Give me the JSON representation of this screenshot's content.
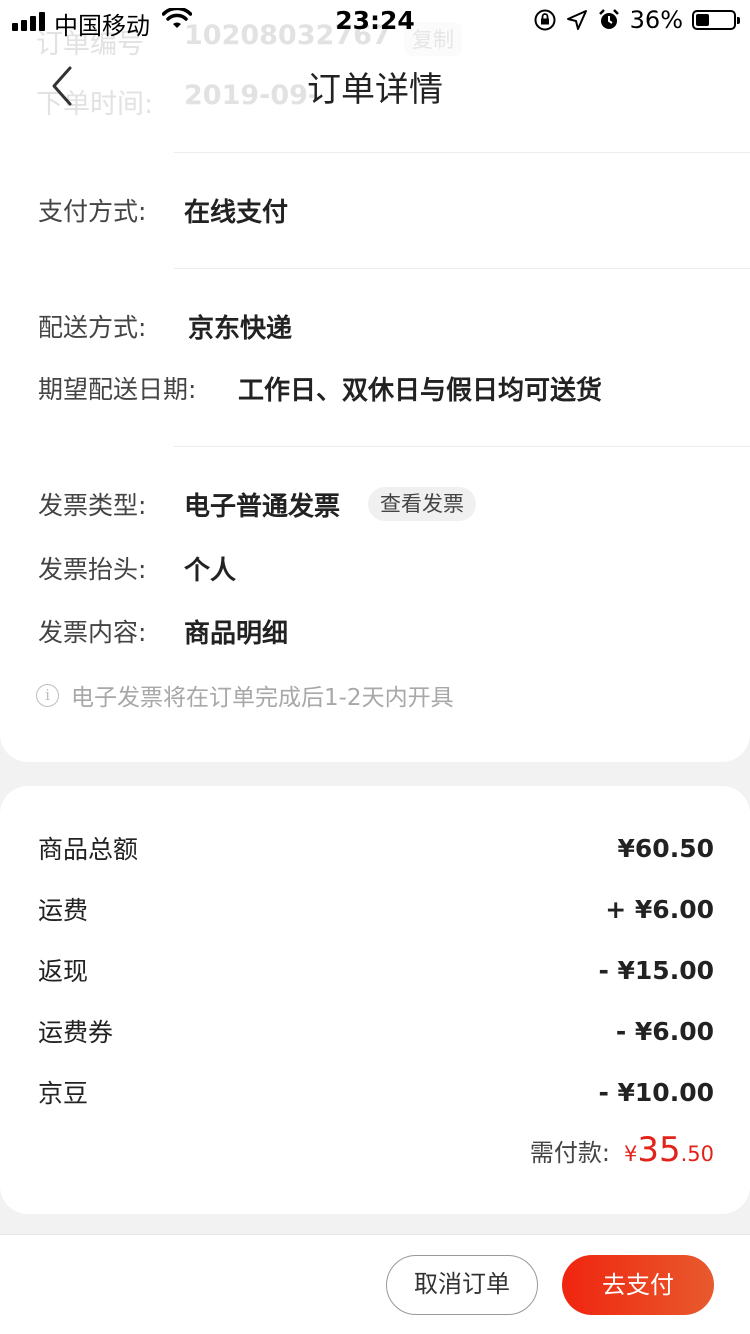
{
  "status_bar": {
    "carrier": "中国移动",
    "time": "23:24",
    "battery_percent": "36%",
    "battery_level": 0.36,
    "icons": [
      "signal-icon",
      "wifi-icon",
      "rotation-lock-icon",
      "location-icon",
      "alarm-icon",
      "battery-icon"
    ]
  },
  "ghost": {
    "order_no_label": "订单编号",
    "order_no_value": "10208032767",
    "copy_label": "复制",
    "order_time_label": "下单时间:",
    "order_time_value": "2019-09-"
  },
  "nav": {
    "title": "订单详情",
    "back_icon": "chevron-left-icon"
  },
  "payment": {
    "label": "支付方式:",
    "value": "在线支付"
  },
  "delivery": {
    "method_label": "配送方式:",
    "method_value": "京东快递",
    "date_label": "期望配送日期:",
    "date_value": "工作日、双休日与假日均可送货"
  },
  "invoice": {
    "type_label": "发票类型:",
    "type_value": "电子普通发票",
    "view_button": "查看发票",
    "title_label": "发票抬头:",
    "title_value": "个人",
    "content_label": "发票内容:",
    "content_value": "商品明细",
    "note_icon": "info-icon",
    "note": "电子发票将在订单完成后1-2天内开具"
  },
  "amounts": [
    {
      "label": "商品总额",
      "value": "¥60.50"
    },
    {
      "label": "运费",
      "value": "+ ¥6.00"
    },
    {
      "label": "返现",
      "value": "- ¥15.00"
    },
    {
      "label": "运费券",
      "value": "- ¥6.00"
    },
    {
      "label": "京豆",
      "value": "- ¥10.00"
    }
  ],
  "total": {
    "label": "需付款:",
    "currency": "¥",
    "integer": "35",
    "decimal": ".50"
  },
  "actions": {
    "cancel": "取消订单",
    "pay": "去支付"
  },
  "colors": {
    "accent": "#e2231a",
    "pay_gradient_start": "#f0250f",
    "pay_gradient_end": "#e85a2e"
  }
}
